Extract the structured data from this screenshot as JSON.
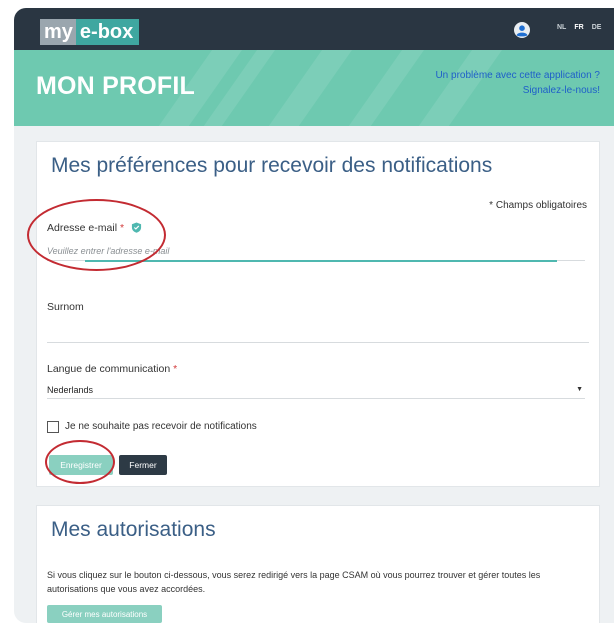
{
  "header": {
    "logo_my": "my",
    "logo_ebox": "e-box",
    "user_icon": "user-circle-icon",
    "languages": [
      {
        "code": "NL",
        "active": false
      },
      {
        "code": "FR",
        "active": true
      },
      {
        "code": "DE",
        "active": false
      }
    ]
  },
  "hero": {
    "title": "MON PROFIL",
    "report_line1": "Un problème avec cette application ?",
    "report_line2": "Signalez-le-nous!"
  },
  "notifications": {
    "title": "Mes préférences pour recevoir des notifications",
    "required_note": "* Champs obligatoires",
    "email_label": "Adresse e-mail",
    "email_icon": "verified-shield-icon",
    "email_placeholder": "Veuillez entrer l'adresse e-mail",
    "email_value": "",
    "surnom_label": "Surnom",
    "surnom_value": "",
    "langue_label": "Langue de communication",
    "langue_value": "Nederlands",
    "checkbox_label": "Je ne souhaite pas recevoir de notifications",
    "checkbox_checked": false,
    "save_label": "Enregistrer",
    "close_label": "Fermer",
    "required_marker": "*"
  },
  "authorizations": {
    "title": "Mes autorisations",
    "description": "Si vous cliquez sur le bouton ci-dessous, vous serez redirigé vers la page CSAM où vous pourrez trouver et gérer toutes les autorisations que vous avez accordées.",
    "button_label": "Gérer mes autorisations"
  },
  "colors": {
    "topbar": "#2a3642",
    "hero": "#6ec9b0",
    "accent": "#4fb8b0",
    "title_blue": "#3b5f86",
    "annotation_red": "#c32b32"
  }
}
